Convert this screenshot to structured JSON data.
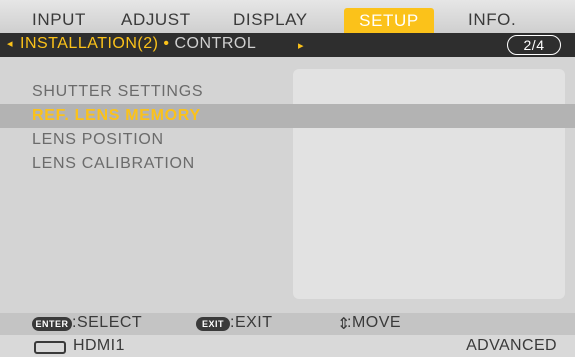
{
  "tabs": [
    "INPUT",
    "ADJUST",
    "DISPLAY",
    "SETUP",
    "INFO."
  ],
  "subheader": {
    "left_arrow": "◂",
    "current": "INSTALLATION(2)",
    "separator": " • ",
    "next": "CONTROL",
    "right_arrow": "▸",
    "page": "2/4"
  },
  "menu_items": [
    "SHUTTER SETTINGS",
    "REF. LENS MEMORY",
    "LENS POSITION",
    "LENS CALIBRATION"
  ],
  "help": {
    "enter_key": "ENTER",
    "enter_label": ":SELECT",
    "exit_key": "EXIT",
    "exit_label": ":EXIT",
    "move_symbol": "⇕",
    "move_label": ":MOVE"
  },
  "footer": {
    "source": "HDMI1",
    "mode": "ADVANCED"
  },
  "colors": {
    "accent": "#fbc21a",
    "background": "#d4d4d4",
    "subbar": "#2e2e2e",
    "highlight": "#b3b3b3"
  }
}
